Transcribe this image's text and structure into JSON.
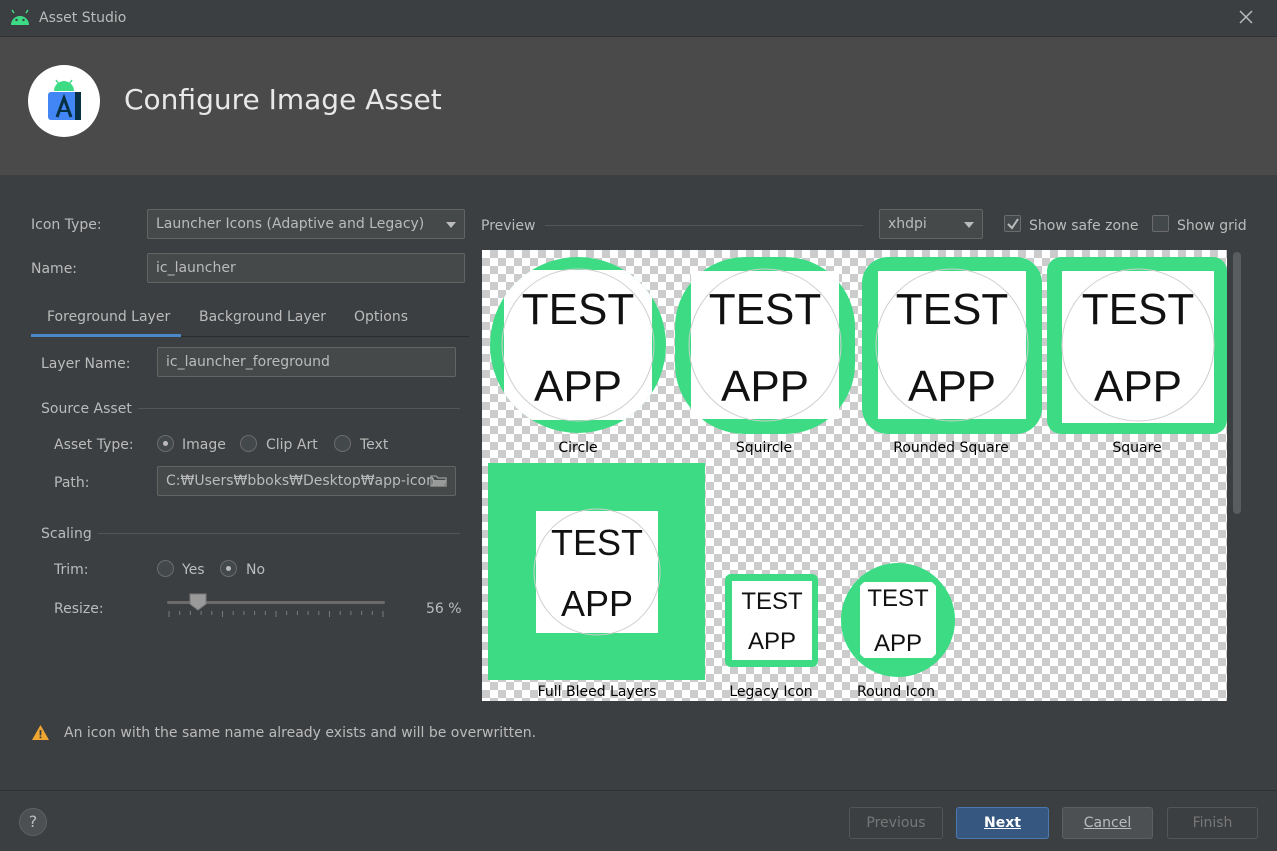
{
  "window": {
    "title": "Asset Studio"
  },
  "header": {
    "title": "Configure Image Asset"
  },
  "form": {
    "icon_type_label": "Icon Type:",
    "icon_type_value": "Launcher Icons (Adaptive and Legacy)",
    "name_label": "Name:",
    "name_value": "ic_launcher",
    "tabs": [
      {
        "label": "Foreground Layer",
        "active": true
      },
      {
        "label": "Background Layer",
        "active": false
      },
      {
        "label": "Options",
        "active": false
      }
    ],
    "layer_name_label": "Layer Name:",
    "layer_name_value": "ic_launcher_foreground",
    "source_asset_title": "Source Asset",
    "asset_type_label": "Asset Type:",
    "asset_type_options": [
      "Image",
      "Clip Art",
      "Text"
    ],
    "asset_type_selected": "Image",
    "path_label": "Path:",
    "path_value": "C:₩Users₩bboks₩Desktop₩app-icon.",
    "scaling_title": "Scaling",
    "trim_label": "Trim:",
    "trim_options": [
      "Yes",
      "No"
    ],
    "trim_selected": "No",
    "resize_label": "Resize:",
    "resize_value": 56,
    "resize_text": "56 %"
  },
  "preview": {
    "label": "Preview",
    "density": "xhdpi",
    "show_safe_zone_label": "Show safe zone",
    "show_safe_zone": true,
    "show_grid_label": "Show grid",
    "show_grid": false,
    "icon_text_line1": "TEST",
    "icon_text_line2": "APP",
    "icons": [
      {
        "label": "Circle"
      },
      {
        "label": "Squircle"
      },
      {
        "label": "Rounded Square"
      },
      {
        "label": "Square"
      },
      {
        "label": "Full Bleed Layers"
      },
      {
        "label": "Legacy Icon"
      },
      {
        "label": "Round Icon"
      }
    ]
  },
  "warning": {
    "text": "An icon with the same name already exists and will be overwritten."
  },
  "buttons": {
    "help": "?",
    "previous": "Previous",
    "next": "Next",
    "cancel": "Cancel",
    "finish": "Finish"
  },
  "colors": {
    "accent_green": "#3ddc84",
    "primary_button": "#365880",
    "tab_underline": "#4a88c7"
  }
}
